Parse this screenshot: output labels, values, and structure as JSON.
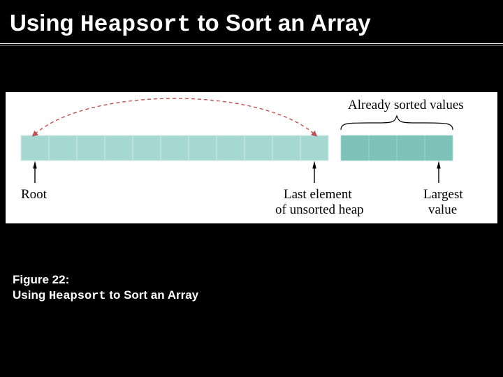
{
  "title": {
    "pre": "Using ",
    "mono": "Heapsort",
    "post": " to Sort an Array"
  },
  "caption": {
    "fig_no": "Figure 22:",
    "pre": "Using ",
    "mono": "Heapsort",
    "post": " to Sort an Array"
  },
  "diagram": {
    "colors": {
      "unsorted_cell": "#a6d8d2",
      "unsorted_stroke": "#d6ece9",
      "sorted_cell": "#7cc2b9",
      "sorted_stroke": "#a6d8d2",
      "swap_arc": "#c0504d",
      "pointer": "#000"
    },
    "labels": {
      "root": "Root",
      "last_l1": "Last element",
      "last_l2": "of unsorted heap",
      "largest_l1": "Largest",
      "largest_l2": "value",
      "sorted_label": "Already sorted values"
    },
    "cells": {
      "unsorted_count": 11,
      "sorted_count": 4,
      "root_index": 0,
      "last_unsorted_index": 10,
      "largest_index": 14
    }
  }
}
